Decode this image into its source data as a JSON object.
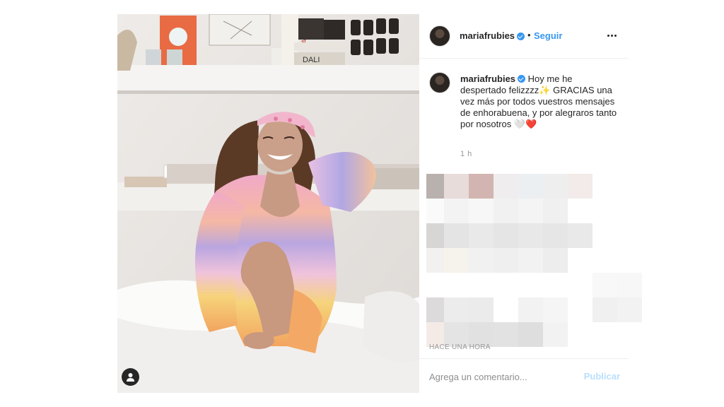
{
  "post": {
    "username": "mariafrubies",
    "verified": true,
    "separator": "•",
    "follow_label": "Seguir",
    "more_icon": "more-options-icon",
    "caption_text": "Hoy me he despertado felizzzz✨ GRACIAS una vez más por todos vuestros mensajes de enhorabuena, y por alegraros tanto por nosotros 🤍❤️",
    "caption_time": "1 h",
    "time_ago": "HACE UNA HORA"
  },
  "comment": {
    "placeholder": "Agrega un comentario...",
    "publish_label": "Publicar"
  },
  "colors": {
    "accent": "#3897f0",
    "publish_disabled": "#b9dffc",
    "text": "#262626",
    "muted": "#999999"
  }
}
